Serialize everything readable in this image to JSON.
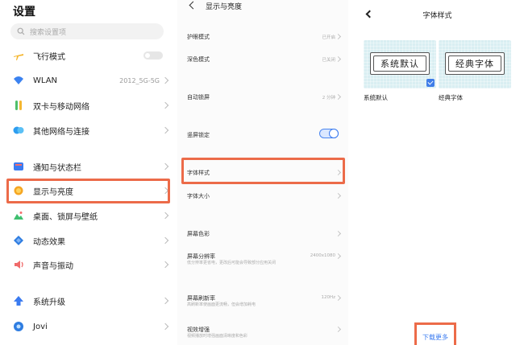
{
  "settings": {
    "title": "设置",
    "search_placeholder": "搜索设置项",
    "items": [
      {
        "label": "飞行模式",
        "value": "",
        "icon": "airplane-icon",
        "color": "#f5b731"
      },
      {
        "label": "WLAN",
        "value": "2012_5G-5G",
        "icon": "wifi-icon",
        "color": "#3b82f0"
      },
      {
        "label": "双卡与移动网络",
        "value": "",
        "icon": "sim-icon",
        "color": "#4fbf6a"
      },
      {
        "label": "其他网络与连接",
        "value": "",
        "icon": "network-icon",
        "color": "#2d9df0"
      },
      {
        "label": "通知与状态栏",
        "value": "",
        "icon": "notification-icon",
        "color": "#3b7bf0"
      },
      {
        "label": "显示与亮度",
        "value": "",
        "icon": "brightness-icon",
        "color": "#f5a623"
      },
      {
        "label": "桌面、锁屏与壁纸",
        "value": "",
        "icon": "wallpaper-icon",
        "color": "#3fbf6f"
      },
      {
        "label": "动态效果",
        "value": "",
        "icon": "motion-icon",
        "color": "#2f7de1"
      },
      {
        "label": "声音与振动",
        "value": "",
        "icon": "sound-icon",
        "color": "#f06a6a"
      },
      {
        "label": "系统升级",
        "value": "",
        "icon": "upgrade-icon",
        "color": "#3b7bf0"
      },
      {
        "label": "Jovi",
        "value": "",
        "icon": "jovi-icon",
        "color": "#2f7de1"
      }
    ]
  },
  "display": {
    "title": "显示与亮度",
    "items": [
      {
        "label": "护眼模式",
        "value": "已开启",
        "sub": ""
      },
      {
        "label": "深色模式",
        "value": "已关闭",
        "sub": ""
      },
      {
        "label": "自动锁屏",
        "value": "2 分钟",
        "sub": ""
      },
      {
        "label": "竖屏锁定",
        "value": "",
        "sub": ""
      },
      {
        "label": "字体样式",
        "value": "",
        "sub": ""
      },
      {
        "label": "字体大小",
        "value": "",
        "sub": ""
      },
      {
        "label": "屏幕色彩",
        "value": "",
        "sub": ""
      },
      {
        "label": "屏幕分辨率",
        "value": "2400x1080",
        "sub": "低分辨率更省电，更改后可能会导致部分应用关闭"
      },
      {
        "label": "屏幕刷新率",
        "value": "120Hz",
        "sub": "高刷新率使画面更流畅，但会增加耗电"
      },
      {
        "label": "视效增强",
        "value": "",
        "sub": "视频播放时增强画面清晰度和色彩"
      }
    ]
  },
  "font_style": {
    "title": "字体样式",
    "fonts": [
      {
        "preview": "系统默认",
        "label": "系统默认",
        "selected": true
      },
      {
        "preview": "经典字体",
        "label": "经典字体",
        "selected": false
      }
    ],
    "download_label": "下载更多"
  },
  "colors": {
    "highlight": "#ec6b49",
    "accent": "#3b7bf0"
  }
}
